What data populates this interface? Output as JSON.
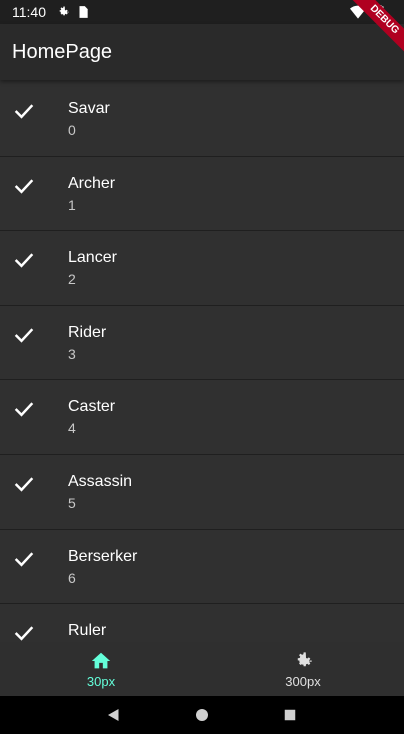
{
  "status": {
    "time": "11:40"
  },
  "app_bar": {
    "title": "HomePage"
  },
  "debug_banner": "DEBUG",
  "list": {
    "items": [
      {
        "title": "Savar",
        "subtitle": "0"
      },
      {
        "title": "Archer",
        "subtitle": "1"
      },
      {
        "title": "Lancer",
        "subtitle": "2"
      },
      {
        "title": "Rider",
        "subtitle": "3"
      },
      {
        "title": "Caster",
        "subtitle": "4"
      },
      {
        "title": "Assassin",
        "subtitle": "5"
      },
      {
        "title": "Berserker",
        "subtitle": "6"
      },
      {
        "title": "Ruler",
        "subtitle": ""
      }
    ]
  },
  "bottom_nav": {
    "items": [
      {
        "label": "30px",
        "icon": "home-icon",
        "active": true
      },
      {
        "label": "300px",
        "icon": "gear-icon",
        "active": false
      }
    ]
  },
  "colors": {
    "accent": "#64ffda",
    "background": "#303030",
    "app_bar": "#2a2a2a",
    "debug": "#b00020"
  }
}
